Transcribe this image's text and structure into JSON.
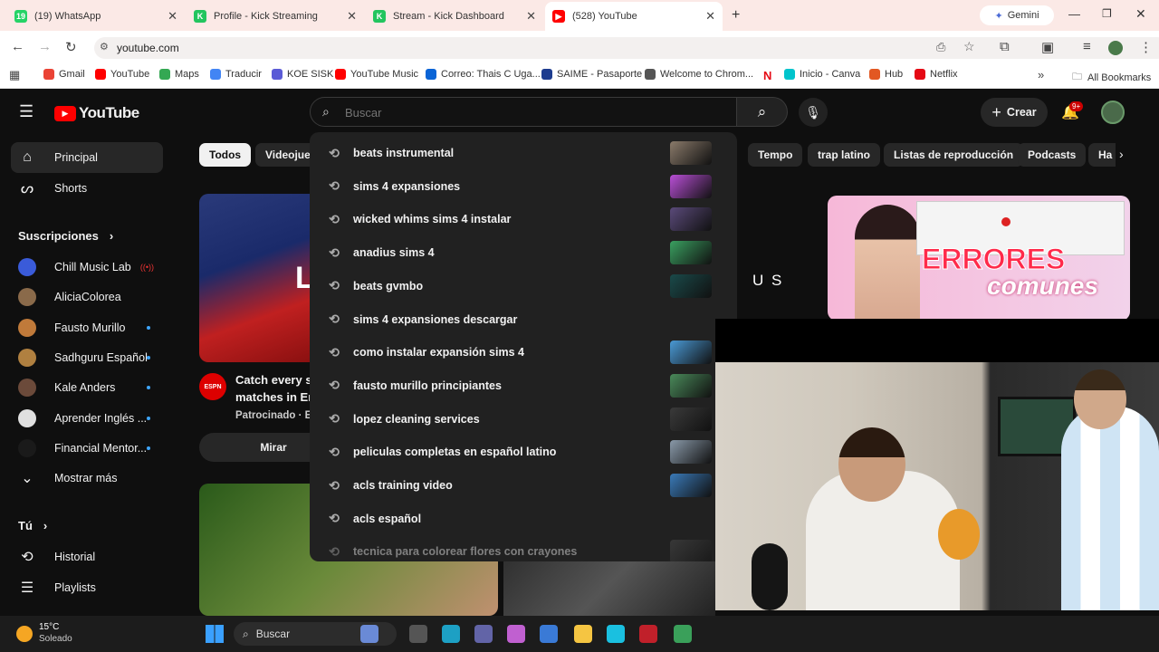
{
  "browser": {
    "tabs": [
      {
        "title": "(19) WhatsApp",
        "color": "#25d366",
        "glyph": "19"
      },
      {
        "title": "Profile - Kick Streaming",
        "color": "#22c55e",
        "glyph": "K"
      },
      {
        "title": "Stream - Kick Dashboard",
        "color": "#22c55e",
        "glyph": "K"
      },
      {
        "title": "(528) YouTube",
        "color": "#ff0000",
        "glyph": "▶"
      }
    ],
    "new_tab": "+",
    "gemini_label": "Gemini",
    "url": "youtube.com",
    "bookmarks": [
      {
        "label": "Gmail",
        "color": "#ea4335"
      },
      {
        "label": "YouTube",
        "color": "#ff0000"
      },
      {
        "label": "Maps",
        "color": "#34a853"
      },
      {
        "label": "Traducir",
        "color": "#4285f4"
      },
      {
        "label": "KOE SISK",
        "color": "#5b5bd6"
      },
      {
        "label": "YouTube Music",
        "color": "#ff0000"
      },
      {
        "label": "Correo: Thais C Uga...",
        "color": "#0a64d6"
      },
      {
        "label": "SAIME - Pasaporte",
        "color": "#1d3c8f"
      },
      {
        "label": "Welcome to Chrom...",
        "color": "#555555"
      },
      {
        "label": "Inicio - Canva",
        "color": "#00c4cc"
      },
      {
        "label": "Hub",
        "color": "#e25822"
      },
      {
        "label": "Netflix",
        "color": "#e50914"
      }
    ],
    "all_bookmarks": "All Bookmarks"
  },
  "youtube": {
    "logo_text": "YouTube",
    "search_placeholder": "Buscar",
    "create_label": "Crear",
    "notif_badge": "9+",
    "sidebar": {
      "main": [
        {
          "label": "Principal",
          "icon": "home-icon"
        },
        {
          "label": "Shorts",
          "icon": "shorts-icon"
        }
      ],
      "subs_header": "Suscripciones",
      "subs": [
        {
          "label": "Chill Music Lab",
          "color": "#3a5bd9"
        },
        {
          "label": "AliciaColorea",
          "color": "#8a6a4a"
        },
        {
          "label": "Fausto Murillo",
          "color": "#c07a3a"
        },
        {
          "label": "Sadhguru Español",
          "color": "#b08040"
        },
        {
          "label": "Kale Anders",
          "color": "#6b4a3a"
        },
        {
          "label": "Aprender Inglés ...",
          "color": "#e0e0e0"
        },
        {
          "label": "Financial Mentor...",
          "color": "#1a1a1a"
        }
      ],
      "show_more": "Mostrar más",
      "you_header": "Tú",
      "you": [
        {
          "label": "Historial",
          "icon": "history-icon"
        },
        {
          "label": "Playlists",
          "icon": "playlist-icon"
        }
      ]
    },
    "chips_left": [
      "Todos",
      "Videojueg"
    ],
    "chips_right": [
      "Tempo",
      "trap latino",
      "Listas de reproducción",
      "Podcasts",
      "Ha"
    ],
    "ad": {
      "title": "Catch every s",
      "title2": "matches in En",
      "sponsored": "Patrocinado · E",
      "button": "Mirar",
      "channel_badge": "ESPN"
    },
    "thumb_right_text1": "ERRORES",
    "thumb_right_text2": "comunes",
    "thumb_mid_text": "U S",
    "suggestions": [
      {
        "text": "beats instrumental",
        "thumb": "#8a7a6a"
      },
      {
        "text": "sims 4 expansiones",
        "thumb": "#b94fd6"
      },
      {
        "text": "wicked whims sims 4 instalar",
        "thumb": "#5a4a7a"
      },
      {
        "text": "anadius sims 4",
        "thumb": "#3aa060"
      },
      {
        "text": "beats gvmbo",
        "thumb": "#1a4a4a"
      },
      {
        "text": "sims 4 expansiones descargar",
        "thumb": ""
      },
      {
        "text": "como instalar expansión sims 4",
        "thumb": "#4a9ad6"
      },
      {
        "text": "fausto murillo principiantes",
        "thumb": "#4a8a5a"
      },
      {
        "text": "lopez cleaning services",
        "thumb": "#3a3a3a"
      },
      {
        "text": "peliculas completas en español latino",
        "thumb": "#8a9aaa"
      },
      {
        "text": "acls training video",
        "thumb": "#3a7ab9"
      },
      {
        "text": "acls español",
        "thumb": ""
      },
      {
        "text": "tecnica para colorear flores con crayones",
        "thumb": "#555555"
      }
    ]
  },
  "taskbar": {
    "temp": "15°C",
    "weather": "Soleado",
    "search": "Buscar"
  }
}
